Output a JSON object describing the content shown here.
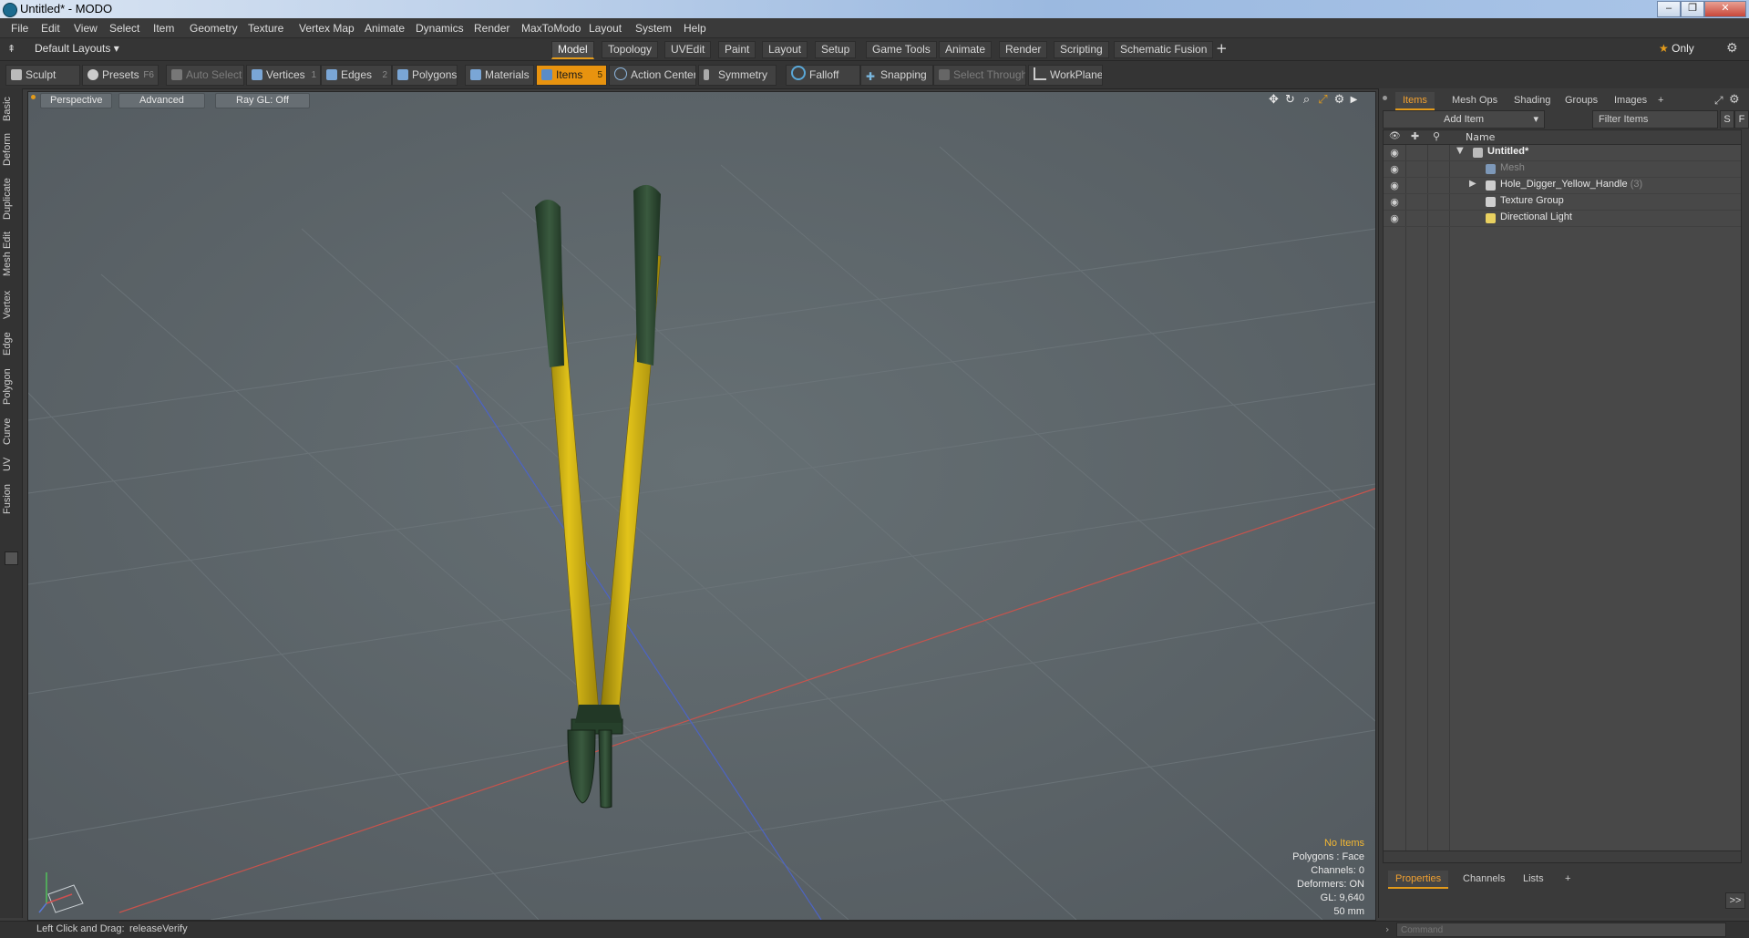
{
  "window": {
    "title": "Untitled* - MODO",
    "controls": [
      "–",
      "❐",
      "✕"
    ]
  },
  "menu": [
    "File",
    "Edit",
    "View",
    "Select",
    "Item",
    "Geometry",
    "Texture",
    "Vertex Map",
    "Animate",
    "Dynamics",
    "Render",
    "MaxToModo",
    "Layout",
    "System",
    "Help"
  ],
  "layout_bar": {
    "layouts_label": "Default Layouts",
    "tabs": [
      "Model",
      "Topology",
      "UVEdit",
      "Paint",
      "Layout",
      "Setup",
      "Game Tools",
      "Animate",
      "Render",
      "Scripting",
      "Schematic Fusion"
    ],
    "add_tab": "+",
    "only_label": "Only"
  },
  "toolbar": {
    "sculpt": "Sculpt",
    "presets": "Presets",
    "presets_key": "F6",
    "auto_select": "Auto Select",
    "vertices": "Vertices",
    "vertices_key": "1",
    "edges": "Edges",
    "edges_key": "2",
    "polygons": "Polygons",
    "materials": "Materials",
    "items": "Items",
    "items_key": "5",
    "action_center": "Action Center",
    "symmetry": "Symmetry",
    "falloff": "Falloff",
    "snapping": "Snapping",
    "select_through": "Select Through",
    "workplane": "WorkPlane"
  },
  "left_tabs": [
    "Basic",
    "Deform",
    "Duplicate",
    "Mesh Edit",
    "Vertex",
    "Edge",
    "Polygon",
    "Curve",
    "UV",
    "Fusion"
  ],
  "viewport": {
    "view_mode": "Perspective",
    "shading": "Advanced",
    "raygl": "Ray GL: Off",
    "hud": {
      "selection": "No Items",
      "polygons": "Polygons : Face",
      "channels": "Channels: 0",
      "deformers": "Deformers: ON",
      "gl": "GL: 9,640",
      "size": "50 mm"
    }
  },
  "status": {
    "hint_label": "Left Click and Drag:",
    "hint_value": "releaseVerify"
  },
  "right_panel": {
    "tabs": [
      "Items",
      "Mesh Ops",
      "Shading",
      "Groups",
      "Images"
    ],
    "add_tab": "+",
    "add_item": "Add Item",
    "filter_placeholder": "Filter Items",
    "s_btn": "S",
    "f_btn": "F",
    "name_header": "Name",
    "tree": [
      {
        "label": "Untitled*",
        "count": ""
      },
      {
        "label": "Mesh",
        "count": ""
      },
      {
        "label": "Hole_Digger_Yellow_Handle",
        "count": "(3)"
      },
      {
        "label": "Texture Group",
        "count": ""
      },
      {
        "label": "Directional Light",
        "count": ""
      }
    ],
    "bottom_tabs": [
      "Properties",
      "Channels",
      "Lists"
    ],
    "bottom_add": "+",
    "expand_btn": ">>",
    "command_placeholder": "Command"
  },
  "colors": {
    "accent": "#e39b1b",
    "viewport_bg": "#5e666b",
    "handle_yellow": "#d8b414",
    "grip_green": "#2e4a32"
  }
}
